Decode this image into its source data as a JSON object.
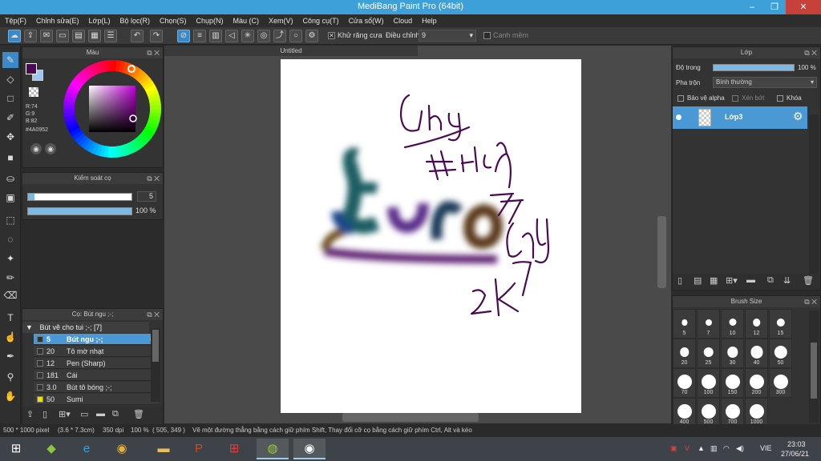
{
  "app": {
    "title": "MediBang Paint Pro (64bit)",
    "window_controls": [
      "minimize-icon",
      "restore-icon",
      "close-icon"
    ]
  },
  "menu": [
    "Tệp(F)",
    "Chỉnh sửa(E)",
    "Lớp(L)",
    "Bộ lọc(R)",
    "Chọn(S)",
    "Chụp(N)",
    "Màu (C)",
    "Xem(V)",
    "Công cụ(T)",
    "Cửa sổ(W)",
    "Cloud",
    "Help"
  ],
  "toolbar": {
    "antialias_label": "Khử răng cưa",
    "antialias_checked": true,
    "adjust_label": "Điều chỉnh",
    "adjust_value": "9",
    "smooth_label": "Canh mềm",
    "smooth_checked": false
  },
  "tools": [
    "brush-tool",
    "eraser-tool",
    "shape-tool",
    "pen-tool",
    "move-tool",
    "fill-rect-tool",
    "bucket-tool",
    "gradient-tool",
    "select-rect-tool",
    "lasso-tool",
    "magic-wand-tool",
    "select-pen-tool",
    "select-eraser-tool",
    "text-tool",
    "operation-tool",
    "eyedropper-tool",
    "dropper-tool",
    "hand-tool"
  ],
  "color_panel": {
    "title": "Màu",
    "primary_color": "#4A0952",
    "r_label": "R:74",
    "g_label": "G:9",
    "b_label": "B:82",
    "hex_label": "#4A0952"
  },
  "brush_control": {
    "title": "Kiểm soát cọ",
    "size_value": "5",
    "size_fraction": 0.06,
    "opacity_value": "100 %",
    "opacity_fraction": 1.0
  },
  "brush_panel": {
    "title": "Cọ: Bút ngu ;-;",
    "group": "Bút vẽ cho tui ;-; [7]",
    "items": [
      {
        "size": "5",
        "name": "Bút ngu ;-;",
        "color": "#333333",
        "selected": true
      },
      {
        "size": "20",
        "name": "Tô mờ nhạt",
        "color": "#333333",
        "selected": false
      },
      {
        "size": "12",
        "name": "Pen (Sharp)",
        "color": "#333333",
        "selected": false
      },
      {
        "size": "181",
        "name": "Cái",
        "color": "#333333",
        "selected": false
      },
      {
        "size": "3.0",
        "name": "Bút tô bóng ;-;",
        "color": "#333333",
        "selected": false
      },
      {
        "size": "50",
        "name": "Sumi",
        "color": "#f2e100",
        "selected": false
      }
    ]
  },
  "document": {
    "tab_title": "Untitled",
    "strokes": [
      "Ohng",
      "#Hoi dap",
      "A7",
      "Ohng",
      "Euro",
      "2K7"
    ]
  },
  "layer_panel": {
    "title": "Lớp",
    "opacity_label": "Độ trong",
    "opacity_value": "100 %",
    "opacity_fraction": 1.0,
    "blend_label": "Pha trộn",
    "blend_value": "Bình thường",
    "protect_alpha": "Bảo vệ alpha",
    "clipping": "Xén bớt",
    "lock": "Khóa",
    "layers": [
      {
        "name": "Lớp3",
        "selected": true
      }
    ]
  },
  "brush_size_panel": {
    "title": "Brush Size",
    "sizes": [
      "5",
      "7",
      "10",
      "12",
      "15",
      "20",
      "25",
      "30",
      "40",
      "50",
      "70",
      "100",
      "150",
      "200",
      "300",
      "400",
      "500",
      "700",
      "1000"
    ]
  },
  "status": {
    "dims": "500 * 1000 pixel",
    "cm": "(3.6 * 7.3cm)",
    "dpi": "350 dpi",
    "zoom": "100 %",
    "coord": "( 505, 349 )",
    "hint": "Vẽ một đường thẳng bằng cách giữ phím Shift, Thay đổi cỡ cọ bằng cách giữ phím Ctrl, Alt và kéo"
  },
  "taskbar": {
    "apps": [
      "windows-start-icon",
      "bluestacks-icon",
      "internet-explorer-icon",
      "chrome-icon",
      "file-explorer-icon",
      "powerpoint-icon",
      "app-grid-icon",
      "medibang-icon",
      "medibang-paint-icon"
    ],
    "lang": "VIE",
    "time": "23:03",
    "date": "27/06/21"
  }
}
